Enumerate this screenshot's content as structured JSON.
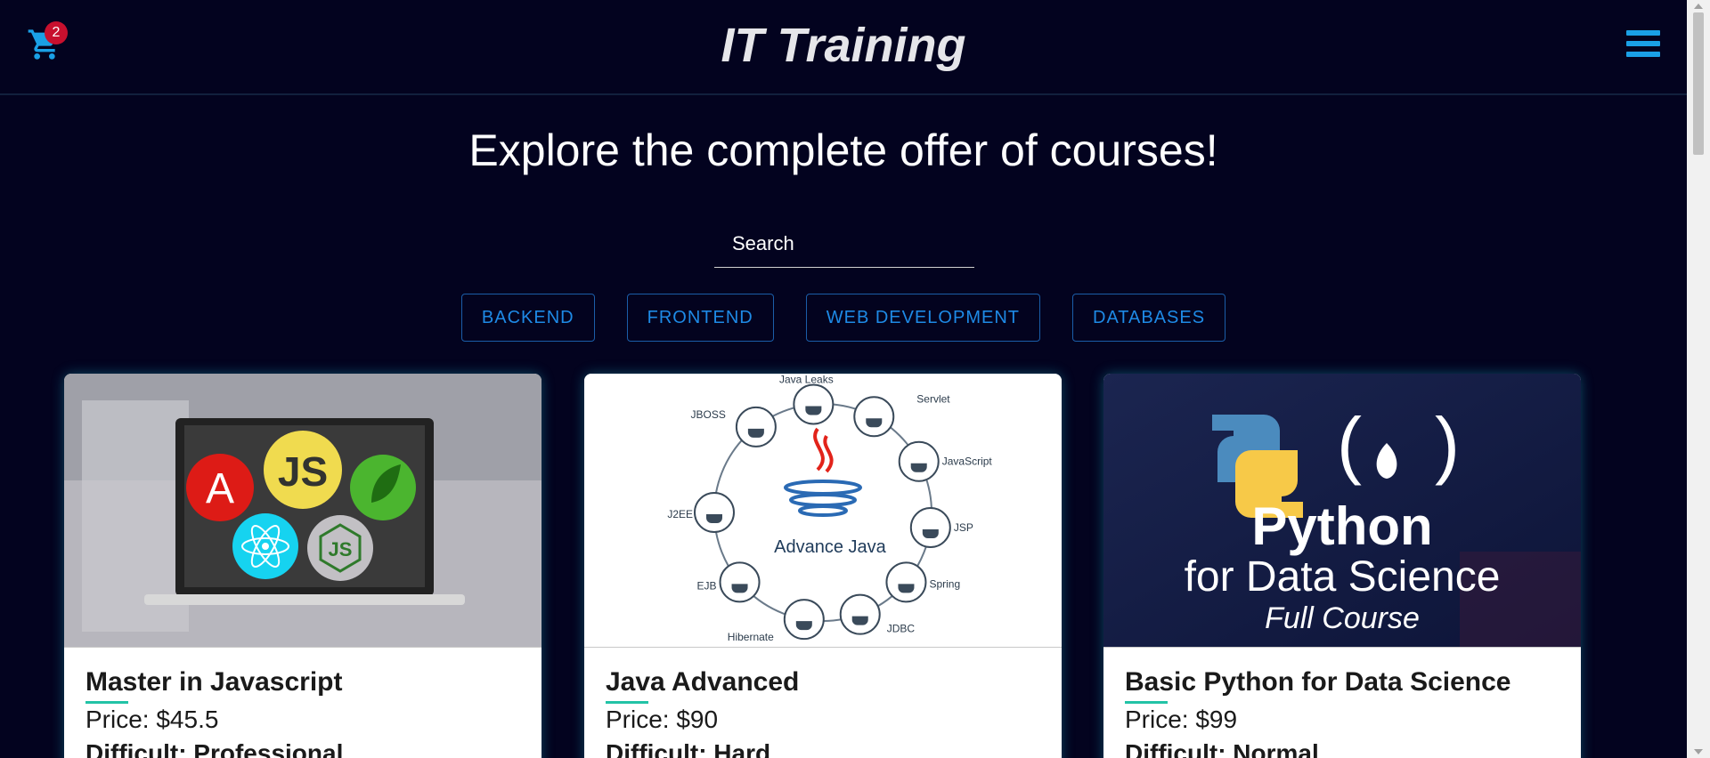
{
  "header": {
    "brand": "IT Training",
    "cart_count": "2"
  },
  "hero": {
    "title": "Explore the complete offer of courses!"
  },
  "search": {
    "placeholder": "Search"
  },
  "filters": [
    "BACKEND",
    "FRONTEND",
    "WEB DEVELOPMENT",
    "DATABASES"
  ],
  "courses": [
    {
      "title": "Master in Javascript",
      "price": "Price: $45.5",
      "difficulty": "Difficult: Professional",
      "image_logos": [
        "A",
        "JS",
        "JS"
      ]
    },
    {
      "title": "Java Advanced",
      "price": "Price: $90",
      "difficulty": "Difficult: Hard",
      "image_caption": "Advance Java",
      "image_labels": [
        "Java Leaks",
        "Servlet",
        "JBOSS",
        "JavaScript",
        "J2EE",
        "JSP",
        "EJB",
        "Spring",
        "Hibernate",
        "JDBC"
      ]
    },
    {
      "title": "Basic Python for Data Science",
      "price": "Price: $99",
      "difficulty": "Difficult: Normal",
      "image_text": {
        "line1": "Python",
        "line2": "for Data Science",
        "line3": "Full Course"
      }
    }
  ],
  "colors": {
    "background": "#03031f",
    "accent": "#1aa0e6",
    "badge": "#c8102e",
    "filter_text": "#1e8ae6",
    "underline": "#22c3a6"
  },
  "icons": {
    "cart": "cart-icon",
    "menu": "hamburger-menu-icon"
  }
}
